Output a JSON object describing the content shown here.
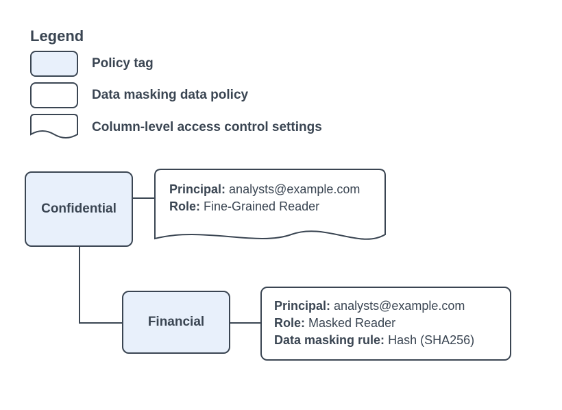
{
  "legend": {
    "title": "Legend",
    "items": [
      {
        "label": "Policy tag"
      },
      {
        "label": "Data masking data policy"
      },
      {
        "label": "Column-level access control settings"
      }
    ]
  },
  "nodes": {
    "confidential": {
      "label": "Confidential"
    },
    "financial": {
      "label": "Financial"
    }
  },
  "accessControl": {
    "principalLabel": "Principal:",
    "principalValue": "analysts@example.com",
    "roleLabel": "Role:",
    "roleValue": "Fine-Grained Reader"
  },
  "dataPolicy": {
    "principalLabel": "Principal:",
    "principalValue": "analysts@example.com",
    "roleLabel": "Role:",
    "roleValue": "Masked Reader",
    "ruleLabel": "Data masking rule:",
    "ruleValue": "Hash (SHA256)"
  }
}
